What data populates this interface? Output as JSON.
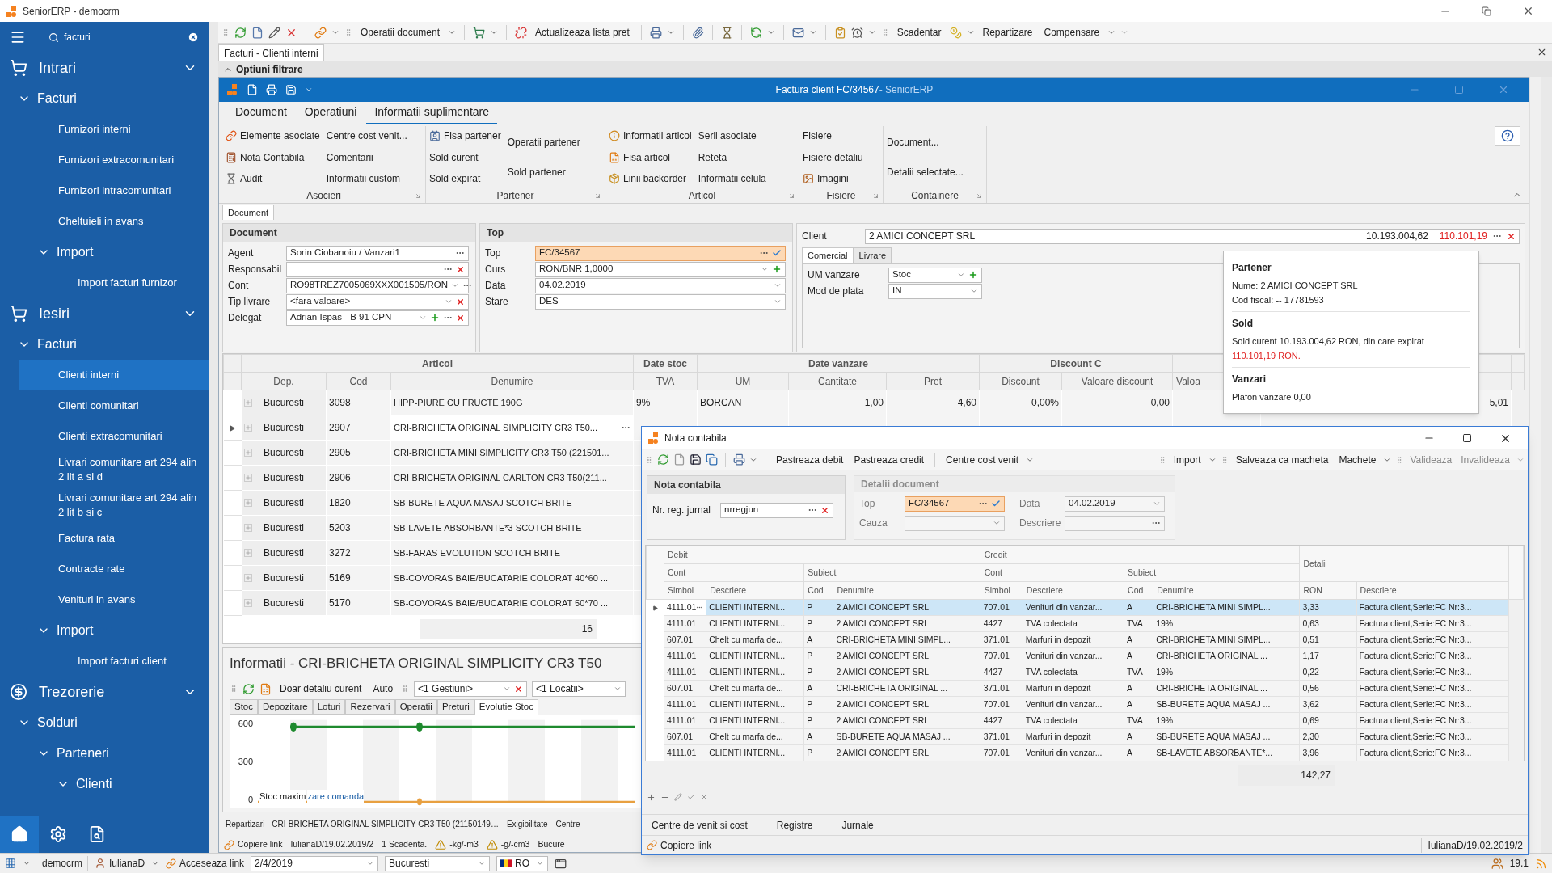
{
  "window": {
    "title": "SeniorERP - democrm"
  },
  "sidebar": {
    "search": {
      "value": "facturi"
    },
    "items": [
      {
        "label": "Intrari",
        "expanded": true,
        "selected": false,
        "children": [
          {
            "label": "Facturi",
            "expanded": true,
            "selected": false,
            "children": [
              {
                "label": "Furnizori interni",
                "selected": false
              },
              {
                "label": "Furnizori extracomunitari",
                "selected": false
              },
              {
                "label": "Furnizori intracomunitari",
                "selected": false
              },
              {
                "label": "Cheltuieli in avans",
                "selected": false
              },
              {
                "label": "Import",
                "expanded": true,
                "selected": false,
                "children": [
                  {
                    "label": "Import facturi furnizor",
                    "selected": false
                  }
                ]
              }
            ]
          }
        ]
      },
      {
        "label": "Iesiri",
        "expanded": true,
        "selected": false,
        "children": [
          {
            "label": "Facturi",
            "expanded": true,
            "selected": false,
            "children": [
              {
                "label": "Clienti interni",
                "selected": true
              },
              {
                "label": "Clienti comunitari",
                "selected": false
              },
              {
                "label": "Clienti extracomunitari",
                "selected": false
              },
              {
                "label": "Livrari comunitare art 294 alin 2 lit a si d",
                "selected": false
              },
              {
                "label": "Livrari comunitare art 294 alin 2 lit b si c",
                "selected": false
              },
              {
                "label": "Factura rata",
                "selected": false
              },
              {
                "label": "Contracte rate",
                "selected": false
              },
              {
                "label": "Venituri in avans",
                "selected": false
              },
              {
                "label": "Import",
                "expanded": true,
                "selected": false,
                "children": [
                  {
                    "label": "Import facturi client",
                    "selected": false
                  }
                ]
              }
            ]
          }
        ]
      },
      {
        "label": "Trezorerie",
        "expanded": true,
        "selected": false,
        "children": [
          {
            "label": "Solduri",
            "expanded": true,
            "selected": false,
            "children": [
              {
                "label": "Parteneri",
                "expanded": true,
                "selected": false,
                "children": [
                  {
                    "label": "Clienti",
                    "expanded": true,
                    "selected": false
                  }
                ]
              }
            ]
          }
        ]
      }
    ]
  },
  "toolbar": {
    "labels": [
      "Operatii document",
      "Actualizeaza lista pret",
      "Scadentar",
      "Repartizare",
      "Compensare"
    ]
  },
  "document_tabs": [
    {
      "label": "Facturi - Clienti interni",
      "selected": true
    }
  ],
  "filter_bar": {
    "label": "Optiuni filtrare"
  },
  "invoice_window": {
    "title": "Factura client FC/34567",
    "app": " - SeniorERP",
    "ribbon": {
      "tabs": [
        {
          "label": "Document",
          "selected": false
        },
        {
          "label": "Operatiuni",
          "selected": false
        },
        {
          "label": "Informatii suplimentare",
          "selected": true
        }
      ],
      "groups": [
        {
          "title": "Asocieri",
          "columns": [
            [
              "Elemente asociate",
              "Nota Contabila",
              "Audit"
            ],
            [
              "Centre cost venit...",
              "Comentarii",
              "Informatii custom"
            ]
          ]
        },
        {
          "title": "Partener",
          "columns": [
            [
              "Fisa partener",
              "Sold curent",
              "Sold expirat"
            ],
            [
              "Operatii partener",
              "Sold partener"
            ]
          ]
        },
        {
          "title": "Articol",
          "columns": [
            [
              "Informatii articol",
              "Fisa articol",
              "Linii backorder"
            ],
            [
              "Serii asociate",
              "Reteta",
              "Informatii celula"
            ]
          ]
        },
        {
          "title": "Fisiere",
          "columns": [
            [
              "Fisiere",
              "Fisiere detaliu",
              "Imagini"
            ]
          ]
        },
        {
          "title": "Containere",
          "columns": [
            [
              "Document...",
              "Detalii selectate..."
            ]
          ]
        }
      ]
    },
    "form_tabs": [
      {
        "label": "Document",
        "selected": true
      }
    ],
    "document_panel": {
      "title": "Document",
      "fields": [
        {
          "label": "Agent",
          "value": "Sorin Ciobanoiu / Vanzari1"
        },
        {
          "label": "Responsabil"
        },
        {
          "label": "Cont",
          "value": "RO98TREZ7005069XXX001505/RON"
        },
        {
          "label": "Tip livrare",
          "value": "<fara valoare>"
        },
        {
          "label": "Delegat",
          "value": "Adrian  Ispas - B 91 CPN"
        }
      ]
    },
    "top_panel": {
      "title": "Top",
      "fields": [
        {
          "label": "Top",
          "value": "FC/34567",
          "highlighted": true
        },
        {
          "label": "Curs",
          "value": "RON/BNR 1,0000",
          "highlighted": false
        },
        {
          "label": "Data",
          "value": "04.02.2019",
          "highlighted": false
        },
        {
          "label": "Stare",
          "value": "DES",
          "highlighted": false
        }
      ]
    },
    "client_panel": {
      "label": "Client",
      "value": "2 AMICI CONCEPT SRL",
      "balance": "10.193.004,62",
      "overdue": "110.101,19",
      "tabs": [
        {
          "label": "Comercial",
          "selected": true
        },
        {
          "label": "Livrare",
          "selected": false
        }
      ],
      "fields": [
        {
          "label": "UM vanzare",
          "value": "Stoc"
        },
        {
          "label": "Mod de plata",
          "value": "IN"
        }
      ]
    },
    "articles": {
      "groups": [
        {
          "label": "Articol",
          "columns": [
            "Dep.",
            "Cod",
            "Denumire"
          ]
        },
        {
          "label": "Date stoc",
          "columns": [
            "TVA"
          ]
        },
        {
          "label": "Date vanzare",
          "columns": [
            "UM",
            "Cantitate",
            "Pret"
          ]
        },
        {
          "label": "Discount C",
          "columns": [
            "Discount",
            "Valoare discount"
          ]
        },
        {
          "columns": [
            "Valoa"
          ]
        }
      ],
      "rows": [
        {
          "current": false,
          "cells": [
            "Bucuresti",
            "3098",
            "HIPP-PIURE CU FRUCTE 190G",
            "9%",
            "BORCAN",
            "1,00",
            "4,60",
            "0,00%",
            "0,00",
            null,
            "5,01"
          ]
        },
        {
          "current": true,
          "cells": [
            "Bucuresti",
            "2907",
            "CRI-BRICHETA ORIGINAL SIMPLICITY CR3 T50..."
          ]
        },
        {
          "current": false,
          "cells": [
            "Bucuresti",
            "2905",
            "CRI-BRICHETA MINI SIMPLICITY CR3 T50 (221501..."
          ]
        },
        {
          "current": false,
          "cells": [
            "Bucuresti",
            "2906",
            "CRI-BRICHETA ORIGINAL CARLTON CR3 T50(211..."
          ]
        },
        {
          "current": false,
          "cells": [
            "Bucuresti",
            "1820",
            "SB-BURETE AQUA MASAJ SCOTCH BRITE"
          ]
        },
        {
          "current": false,
          "cells": [
            "Bucuresti",
            "5203",
            "SB-LAVETE ABSORBANTE*3 SCOTCH BRITE"
          ]
        },
        {
          "current": false,
          "cells": [
            "Bucuresti",
            "3272",
            "SB-FARAS EVOLUTION SCOTCH BRITE"
          ]
        },
        {
          "current": false,
          "cells": [
            "Bucuresti",
            "5169",
            "SB-COVORAS BAIE/BUCATARIE COLORAT 40*60 ..."
          ]
        },
        {
          "current": false,
          "cells": [
            "Bucuresti",
            "5170",
            "SB-COVORAS BAIE/BUCATARIE COLORAT 50*70 ..."
          ]
        }
      ],
      "count": "16"
    },
    "info_panel": {
      "title": "Informatii - CRI-BRICHETA ORIGINAL SIMPLICITY CR3 T50",
      "toolbar": {
        "labels": [
          "Doar detaliu curent",
          "Auto"
        ],
        "gestiuni": "<1 Gestiuni>",
        "locatii": "<1 Locatii>"
      },
      "tabs": [
        {
          "label": "Stoc",
          "selected": false
        },
        {
          "label": "Depozitare",
          "selected": false
        },
        {
          "label": "Loturi",
          "selected": false
        },
        {
          "label": "Rezervari",
          "selected": false
        },
        {
          "label": "Operatii",
          "selected": false
        },
        {
          "label": "Preturi",
          "selected": false
        },
        {
          "label": "Evolutie Stoc",
          "selected": true
        }
      ],
      "y_ticks": [
        "600",
        "300",
        "0"
      ],
      "legend": [
        "Stoc maxim",
        "zare comanda"
      ]
    },
    "bottom_tabs": [
      "Repartizari - CRI-BRICHETA ORIGINAL SIMPLICITY CR3 T50 (21150149…",
      "Exigibilitate",
      "Centre"
    ],
    "status": {
      "link": "Copiere link",
      "items": [
        "IulianaD/19.02.2019/2",
        "1 Scadenta.",
        "-kg/-m3",
        "-g/-cm3",
        "Bucure"
      ]
    }
  },
  "partner_popup": {
    "sections": [
      {
        "title": "Partener",
        "lines": [
          "Nume: 2 AMICI CONCEPT SRL",
          "Cod fiscal: -- 17781593"
        ]
      },
      {
        "title": "Sold",
        "lines": [
          "Sold curent 10.193.004,62 RON, din care expirat"
        ],
        "alert": "110.101,19 RON."
      },
      {
        "title": "Vanzari",
        "lines": [
          "Plafon vanzare 0,00"
        ]
      }
    ]
  },
  "nota_window": {
    "title": "Nota contabila",
    "toolbar": {
      "labels": [
        "Pastreaza debit",
        "Pastreaza credit",
        "Centre cost venit",
        "Import",
        "Salveaza ca macheta",
        "Machete"
      ],
      "disabled_labels": [
        "Valideaza",
        "Invalideaza"
      ]
    },
    "journal_panel": {
      "title": "Nota contabila",
      "fields": [
        {
          "label": "Nr. reg. jurnal",
          "value": "nrregjun"
        }
      ]
    },
    "details_panel": {
      "title": "Detalii document",
      "disabled": true,
      "fields": [
        {
          "label": "Top",
          "value": "FC/34567",
          "highlighted": true
        },
        {
          "label": "Data",
          "value": "04.02.2019",
          "highlighted": false
        },
        {
          "label": "Cauza",
          "highlighted": false
        },
        {
          "label": "Descriere",
          "highlighted": false
        }
      ]
    },
    "grid": {
      "groups": [
        {
          "label": "Debit",
          "subgroups": [
            {
              "label": "Cont",
              "columns": [
                "Simbol",
                "Descriere"
              ]
            },
            {
              "label": "Subiect",
              "columns": [
                "Cod",
                "Denumire"
              ]
            }
          ]
        },
        {
          "label": "Credit",
          "subgroups": [
            {
              "label": "Cont",
              "columns": [
                "Simbol",
                "Descriere"
              ]
            },
            {
              "label": "Subiect",
              "columns": [
                "Cod",
                "Denumire"
              ]
            }
          ]
        },
        {
          "label": "Detalii",
          "columns": [
            "RON",
            "Descriere"
          ]
        }
      ],
      "rows": [
        {
          "selected": true,
          "cells": [
            "4111.01",
            "CLIENTI INTERNI...",
            "P",
            "2 AMICI CONCEPT SRL",
            "707.01",
            "Venituri din vanzar...",
            "A",
            "CRI-BRICHETA MINI SIMPL...",
            "3,33",
            "Factura client,Serie:FC Nr:3..."
          ]
        },
        {
          "selected": false,
          "cells": [
            "4111.01",
            "CLIENTI INTERNI...",
            "P",
            "2 AMICI CONCEPT SRL",
            "4427",
            "TVA colectata",
            "TVA",
            "19%",
            "0,63",
            "Factura client,Serie:FC Nr:3..."
          ]
        },
        {
          "selected": false,
          "cells": [
            "607.01",
            "Chelt cu marfa de...",
            "A",
            "CRI-BRICHETA MINI SIMPL...",
            "371.01",
            "Marfuri in depozit",
            "A",
            "CRI-BRICHETA MINI SIMPL...",
            "0,51",
            "Factura client,Serie:FC Nr:3..."
          ]
        },
        {
          "selected": false,
          "cells": [
            "4111.01",
            "CLIENTI INTERNI...",
            "P",
            "2 AMICI CONCEPT SRL",
            "707.01",
            "Venituri din vanzar...",
            "A",
            "CRI-BRICHETA ORIGINAL ...",
            "1,17",
            "Factura client,Serie:FC Nr:3..."
          ]
        },
        {
          "selected": false,
          "cells": [
            "4111.01",
            "CLIENTI INTERNI...",
            "P",
            "2 AMICI CONCEPT SRL",
            "4427",
            "TVA colectata",
            "TVA",
            "19%",
            "0,22",
            "Factura client,Serie:FC Nr:3..."
          ]
        },
        {
          "selected": false,
          "cells": [
            "607.01",
            "Chelt cu marfa de...",
            "A",
            "CRI-BRICHETA ORIGINAL ...",
            "371.01",
            "Marfuri in depozit",
            "A",
            "CRI-BRICHETA ORIGINAL ...",
            "0,56",
            "Factura client,Serie:FC Nr:3..."
          ]
        },
        {
          "selected": false,
          "cells": [
            "4111.01",
            "CLIENTI INTERNI...",
            "P",
            "2 AMICI CONCEPT SRL",
            "707.01",
            "Venituri din vanzar...",
            "A",
            "SB-BURETE AQUA MASAJ ...",
            "3,62",
            "Factura client,Serie:FC Nr:3..."
          ]
        },
        {
          "selected": false,
          "cells": [
            "4111.01",
            "CLIENTI INTERNI...",
            "P",
            "2 AMICI CONCEPT SRL",
            "4427",
            "TVA colectata",
            "TVA",
            "19%",
            "0,69",
            "Factura client,Serie:FC Nr:3..."
          ]
        },
        {
          "selected": false,
          "cells": [
            "607.01",
            "Chelt cu marfa de...",
            "A",
            "SB-BURETE AQUA MASAJ ...",
            "371.01",
            "Marfuri in depozit",
            "A",
            "SB-BURETE AQUA MASAJ ...",
            "2,30",
            "Factura client,Serie:FC Nr:3..."
          ]
        },
        {
          "selected": false,
          "cells": [
            "4111.01",
            "CLIENTI INTERNI...",
            "P",
            "2 AMICI CONCEPT SRL",
            "707.01",
            "Venituri din vanzar...",
            "A",
            "SB-LAVETE ABSORBANTE*...",
            "3,96",
            "Factura client,Serie:FC Nr:3..."
          ]
        }
      ],
      "total": "142,27"
    },
    "bottom_tabs": [
      "Centre de venit si cost",
      "Registre",
      "Jurnale"
    ],
    "status": {
      "link": "Copiere link",
      "user": "IulianaD/19.02.2019/2"
    }
  },
  "status_bar": {
    "database": "democrm",
    "user": "IulianaD",
    "link": "Acceseaza link",
    "date": "2/4/2019",
    "location": "Bucuresti",
    "language": "RO",
    "version": "19.1"
  }
}
